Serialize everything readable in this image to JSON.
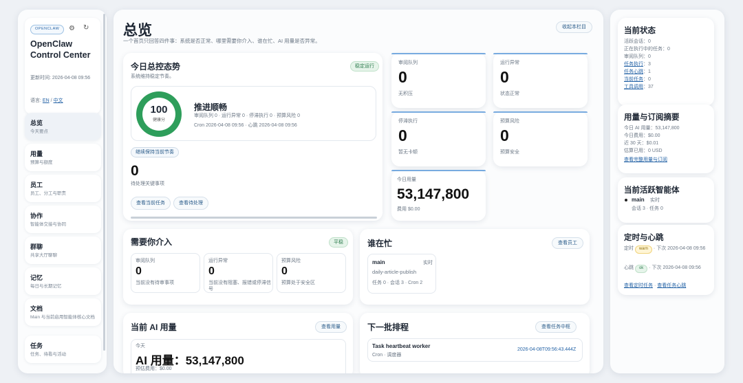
{
  "sidebar": {
    "badge": "OPENCLAW",
    "title": "OpenClaw Control Center",
    "updated": "更新时间: 2026-04-08 09:56",
    "lang_label": "语言:",
    "lang_en": "EN",
    "lang_sep": "/",
    "lang_zh": "中文",
    "items": [
      {
        "label": "总览",
        "sub": "今天要点"
      },
      {
        "label": "用量",
        "sub": "预算与额度"
      },
      {
        "label": "员工",
        "sub": "员工、分工与职责"
      },
      {
        "label": "协作",
        "sub": "智能体交接与协同"
      },
      {
        "label": "群聊",
        "sub": "共享大厅聊聊"
      },
      {
        "label": "记忆",
        "sub": "每日与长期记忆"
      },
      {
        "label": "文档",
        "sub": "Main 与当前启用智能体核心文档"
      },
      {
        "label": "任务",
        "sub": "任务、待看与活动"
      }
    ]
  },
  "header": {
    "title": "总览",
    "subtitle": "一个首页只回答四件事：系统是否正常、哪里需要你介入、谁在忙、AI 用量是否异常。",
    "collapse_btn": "收起本栏目"
  },
  "trend": {
    "title": "今日总控态势",
    "badge": "稳定运行",
    "sub": "系统维持稳定节奏。",
    "score": "100",
    "score_label": "健康分",
    "status": "推进顺畅",
    "line1": "审阅队列 0 · 运行异常 0 · 停滞执行 0 · 预算风险 0",
    "line2": "Cron 2026-04-08 09:56 · 心跳 2026-04-08 09:56",
    "keep_pill": "继续保持当前节奏",
    "pending_count": "0",
    "pending_label": "待处理关键事项",
    "btn_task": "查看当前任务",
    "btn_pending": "查看待处理"
  },
  "stats": [
    {
      "label": "审阅队列",
      "value": "0",
      "sub": "无积压"
    },
    {
      "label": "运行异常",
      "value": "0",
      "sub": "状态正常"
    },
    {
      "label": "停滞执行",
      "value": "0",
      "sub": "暂无卡顿"
    },
    {
      "label": "预算风险",
      "value": "0",
      "sub": "预算安全"
    }
  ],
  "today_usage": {
    "label": "今日用量",
    "value": "53,147,800",
    "sub": "费用 $0.00"
  },
  "intervene": {
    "title": "需要你介入",
    "badge": "平稳",
    "items": [
      {
        "label": "审阅队列",
        "value": "0",
        "sub": "当前没有待审事项"
      },
      {
        "label": "运行异常",
        "value": "0",
        "sub": "当前没有阻塞、报错或停滞信号"
      },
      {
        "label": "预算风险",
        "value": "0",
        "sub": "预算处于安全区"
      }
    ]
  },
  "busy": {
    "title": "谁在忙",
    "btn": "查看员工",
    "agent": "main",
    "agent_state": "实时",
    "task": "daily-article-publish",
    "meta": "任务 0 · 会话 3 · Cron 2"
  },
  "ai_usage": {
    "title": "当前 AI 用量",
    "btn": "查看用量",
    "today_label": "今天",
    "value": "AI 用量：53,147,800",
    "cost": "预估费用：$0.00"
  },
  "schedule": {
    "title": "下一批排程",
    "btn": "查看任务中枢",
    "item_title": "Task heartbeat worker",
    "item_sub": "Cron · 调度器",
    "item_time": "2026-04-08T09:56:43.444Z"
  },
  "status": {
    "title": "当前状态",
    "lines": [
      "活跃会话：0",
      "正在执行中的任务：0",
      "审阅队列：0"
    ],
    "link1": "任务执行",
    "link1_val": "：3",
    "link2": "任务心跳",
    "link2_val": "：1",
    "link3": "当前任务",
    "link3_val": "：0",
    "link4": "工具调用",
    "link4_val": "：37"
  },
  "usage_summary": {
    "title": "用量与订阅摘要",
    "lines": [
      "今日 AI 用量：53,147,800",
      "今日费用：$0.00",
      "近 30 天：$0.01",
      "估算已用：0 USD"
    ],
    "link": "查看完整用量与订阅"
  },
  "active_agent": {
    "title": "当前活跃智能体",
    "name": "main",
    "state": "实时",
    "meta": "会话 3 · 任务 0"
  },
  "heartbeat": {
    "title": "定时与心跳",
    "timer_label": "定时",
    "timer_badge": "warn",
    "timer_next": "· 下次 2026-04-08 09:56",
    "hb_label": "心跳",
    "hb_badge": "ok",
    "hb_next": "· 下次 2026-04-08 09:56",
    "link1": "查看定时任务",
    "link_sep": "·",
    "link2": "查看任务心跳"
  },
  "colors": {
    "accent": "#2563a6",
    "ok": "#2e9e5b",
    "warn": "#e0a400"
  }
}
